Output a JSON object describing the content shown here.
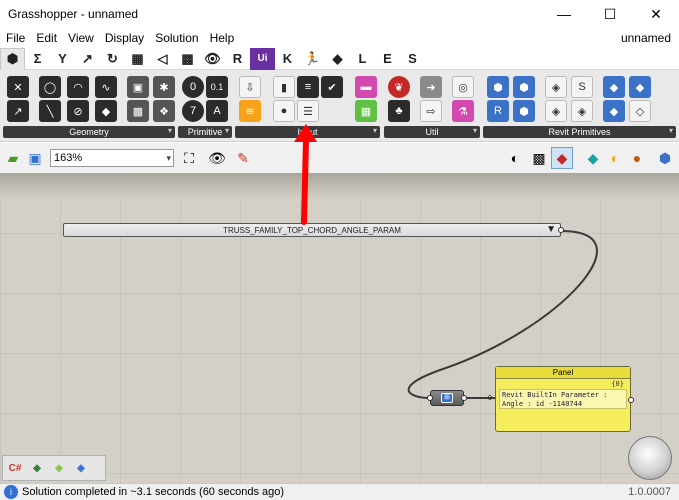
{
  "window": {
    "title": "Grasshopper - unnamed",
    "controls": [
      "—",
      "☐",
      "✕"
    ]
  },
  "menu": {
    "items": [
      "File",
      "Edit",
      "View",
      "Display",
      "Solution",
      "Help"
    ],
    "document_name": "unnamed"
  },
  "tabs": {
    "items": [
      "⬢",
      "Σ",
      "Y",
      "↗",
      "↻",
      "▦",
      "◁",
      "▩",
      "👁",
      "R",
      "Ui",
      "K",
      "🏃",
      "◆",
      "L",
      "E",
      "S"
    ]
  },
  "ribbon": {
    "groups": [
      {
        "label": "Geometry",
        "expander": "▾"
      },
      {
        "label": "Primitive",
        "expander": "▾"
      },
      {
        "label": "Input",
        "expander": "▾"
      },
      {
        "label": "Util",
        "expander": "▾"
      },
      {
        "label": "Revit Primitives",
        "expander": "▾"
      }
    ],
    "primitive_glyphs": [
      "0",
      "0.1",
      "7",
      "A"
    ]
  },
  "toolbar": {
    "zoom": "163%",
    "dropdown": "▾"
  },
  "canvas": {
    "param_node_label": "TRUSS_FAMILY_TOP_CHORD_ANGLE_PARAM",
    "param_node_arrow": "▼",
    "small_node_icon": "⊞",
    "panel": {
      "title": "Panel",
      "index": "{0}",
      "input_label": "0",
      "content_line1": "Revit BuiltIn Parameter :",
      "content_line2": "Angle : id -1140744"
    }
  },
  "bottom_palette": [
    "C#",
    "◈",
    "◈",
    "◈"
  ],
  "status": {
    "message": "Solution completed in ~3.1 seconds (60 seconds ago)",
    "version": "1.0.0007"
  },
  "colors": {
    "annotation": "#ff0000",
    "panel": "#f6ed5c",
    "canvas": "#d4d0c8"
  }
}
